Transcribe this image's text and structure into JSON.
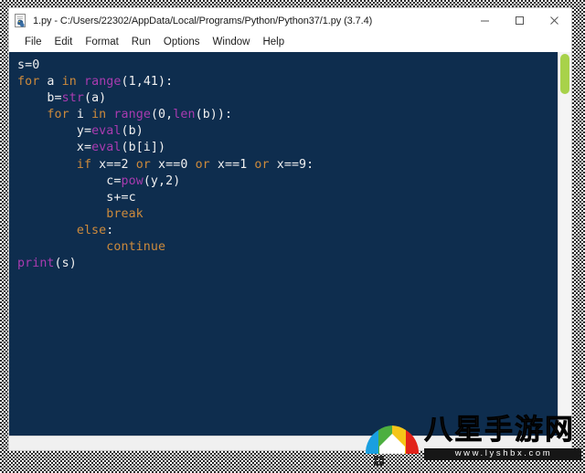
{
  "window": {
    "title": "1.py - C:/Users/22302/AppData/Local/Programs/Python/Python37/1.py (3.7.4)",
    "icon": "python-file-icon",
    "controls": {
      "minimize_label": "–",
      "maximize_label": "☐",
      "close_label": "✕"
    }
  },
  "menubar": {
    "items": [
      {
        "label": "File"
      },
      {
        "label": "Edit"
      },
      {
        "label": "Format"
      },
      {
        "label": "Run"
      },
      {
        "label": "Options"
      },
      {
        "label": "Window"
      },
      {
        "label": "Help"
      }
    ]
  },
  "editor": {
    "background_color": "#0e2d4e",
    "plain_color": "#f0f0f0",
    "keyword_color": "#cc8a3c",
    "builtin_color": "#a93bb0",
    "lines": [
      {
        "indent": 0,
        "tokens": [
          {
            "t": "s=0",
            "c": "pl"
          }
        ]
      },
      {
        "indent": 0,
        "tokens": [
          {
            "t": "for",
            "c": "kw"
          },
          {
            "t": " a ",
            "c": "pl"
          },
          {
            "t": "in",
            "c": "kw"
          },
          {
            "t": " ",
            "c": "pl"
          },
          {
            "t": "range",
            "c": "bi"
          },
          {
            "t": "(1,41):",
            "c": "pl"
          }
        ]
      },
      {
        "indent": 4,
        "tokens": [
          {
            "t": "b=",
            "c": "pl"
          },
          {
            "t": "str",
            "c": "bi"
          },
          {
            "t": "(a)",
            "c": "pl"
          }
        ]
      },
      {
        "indent": 4,
        "tokens": [
          {
            "t": "for",
            "c": "kw"
          },
          {
            "t": " i ",
            "c": "pl"
          },
          {
            "t": "in",
            "c": "kw"
          },
          {
            "t": " ",
            "c": "pl"
          },
          {
            "t": "range",
            "c": "bi"
          },
          {
            "t": "(0,",
            "c": "pl"
          },
          {
            "t": "len",
            "c": "bi"
          },
          {
            "t": "(b)):",
            "c": "pl"
          }
        ]
      },
      {
        "indent": 8,
        "tokens": [
          {
            "t": "y=",
            "c": "pl"
          },
          {
            "t": "eval",
            "c": "bi"
          },
          {
            "t": "(b)",
            "c": "pl"
          }
        ]
      },
      {
        "indent": 8,
        "tokens": [
          {
            "t": "x=",
            "c": "pl"
          },
          {
            "t": "eval",
            "c": "bi"
          },
          {
            "t": "(b[i])",
            "c": "pl"
          }
        ]
      },
      {
        "indent": 8,
        "tokens": [
          {
            "t": "if",
            "c": "kw"
          },
          {
            "t": " x==2 ",
            "c": "pl"
          },
          {
            "t": "or",
            "c": "kw"
          },
          {
            "t": " x==0 ",
            "c": "pl"
          },
          {
            "t": "or",
            "c": "kw"
          },
          {
            "t": " x==1 ",
            "c": "pl"
          },
          {
            "t": "or",
            "c": "kw"
          },
          {
            "t": " x==9:",
            "c": "pl"
          }
        ]
      },
      {
        "indent": 12,
        "tokens": [
          {
            "t": "c=",
            "c": "pl"
          },
          {
            "t": "pow",
            "c": "bi"
          },
          {
            "t": "(y,2)",
            "c": "pl"
          }
        ]
      },
      {
        "indent": 12,
        "tokens": [
          {
            "t": "s+=c",
            "c": "pl"
          }
        ]
      },
      {
        "indent": 12,
        "tokens": [
          {
            "t": "break",
            "c": "kw"
          }
        ]
      },
      {
        "indent": 8,
        "tokens": [
          {
            "t": "else",
            "c": "kw"
          },
          {
            "t": ":",
            "c": "pl"
          }
        ]
      },
      {
        "indent": 12,
        "tokens": [
          {
            "t": "continue",
            "c": "kw"
          }
        ]
      },
      {
        "indent": 0,
        "tokens": [
          {
            "t": "print",
            "c": "bi"
          },
          {
            "t": "(s)",
            "c": "pl"
          }
        ]
      }
    ]
  },
  "scrollbar": {
    "thumb_color": "#a8d24a"
  },
  "watermark": {
    "site_name": "八星手游网",
    "url": "www.lyshbx.com",
    "logo_colors": [
      "#1a9fe0",
      "#4caf3f",
      "#f5c518",
      "#e2231a"
    ]
  }
}
